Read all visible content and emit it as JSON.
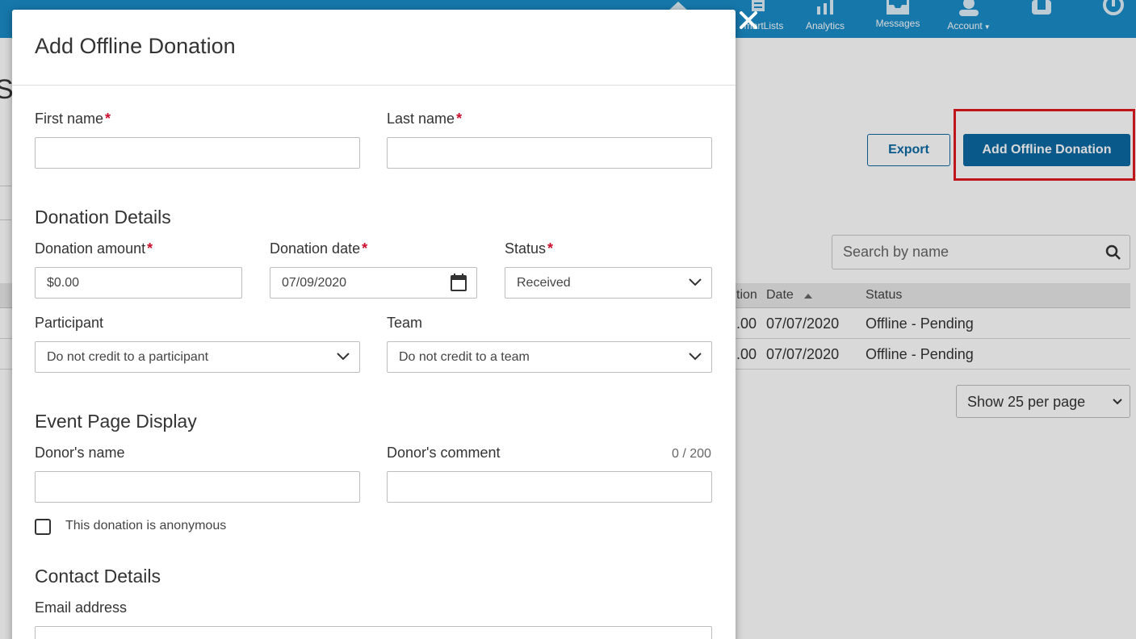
{
  "nav": {
    "items": [
      {
        "label": "SmartLists",
        "icon": "list-icon"
      },
      {
        "label": "Analytics",
        "icon": "analytics-icon"
      },
      {
        "label": "Messages",
        "icon": "inbox-icon"
      },
      {
        "label": "Account",
        "icon": "user-icon"
      }
    ],
    "smartlists_label": "martLists",
    "analytics_label": "Analytics",
    "messages_label": "Messages",
    "account_label": "Account"
  },
  "page": {
    "title_fragment": "S"
  },
  "toolbar": {
    "export_label": "Export",
    "add_label": "Add Offline Donation"
  },
  "search": {
    "placeholder": "Search by name"
  },
  "table": {
    "headers": {
      "donation": "tion",
      "date": "Date",
      "status": "Status"
    },
    "rows": [
      {
        "amount": ".00",
        "date": "07/07/2020",
        "status": "Offline - Pending"
      },
      {
        "amount": ".00",
        "date": "07/07/2020",
        "status": "Offline - Pending"
      }
    ]
  },
  "pagination": {
    "per_page": "Show 25 per page"
  },
  "modal": {
    "title": "Add Offline Donation",
    "first_name_label": "First name",
    "last_name_label": "Last name",
    "required_mark": "*",
    "donation_details_title": "Donation Details",
    "amount_label": "Donation amount",
    "amount_value": "$0.00",
    "date_label": "Donation date",
    "date_value": "07/09/2020",
    "status_label": "Status",
    "status_value": "Received",
    "participant_label": "Participant",
    "participant_value": "Do not credit to a participant",
    "team_label": "Team",
    "team_value": "Do not credit to a team",
    "event_display_title": "Event Page Display",
    "donor_name_label": "Donor's name",
    "donor_comment_label": "Donor's comment",
    "comment_counter": "0 / 200",
    "anonymous_label": "This donation is anonymous",
    "contact_title": "Contact Details",
    "email_label": "Email address"
  },
  "colors": {
    "topbar": "#1a8cc8",
    "primary": "#0b69a3",
    "required": "#c8102e",
    "highlight": "#e11b22"
  }
}
